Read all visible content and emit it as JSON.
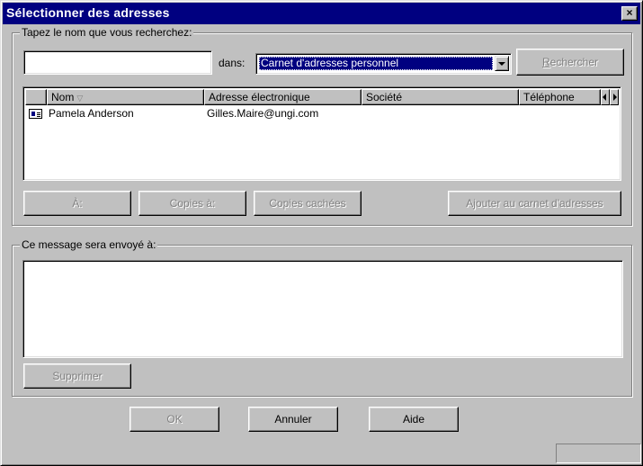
{
  "window": {
    "title": "Sélectionner des adresses",
    "close_label": "×"
  },
  "search_group": {
    "label": "Tapez le nom que vous recherchez:",
    "search_value": "",
    "in_label": "dans:",
    "directory_selected": "Carnet d'adresses personnel",
    "search_button": "Rechercher"
  },
  "results": {
    "columns": [
      "Nom",
      "Adresse électronique",
      "Société",
      "Téléphone"
    ],
    "sort_indicator": "▽",
    "rows": [
      {
        "name": "Pamela Anderson",
        "email": "Gilles.Maire@ungi.com",
        "company": "",
        "phone": ""
      }
    ]
  },
  "action_buttons": {
    "to": "À:",
    "cc": "Copies à:",
    "bcc": "Copies cachées",
    "add_to_book": "Ajouter au carnet d'adresses"
  },
  "recipients_group": {
    "label": "Ce message sera envoyé à:",
    "remove_button": "Supprimer"
  },
  "footer": {
    "ok": "OK",
    "cancel": "Annuler",
    "help": "Aide"
  },
  "colors": {
    "title_bar": "#000080",
    "face": "#c0c0c0",
    "selection": "#000080",
    "disabled_text": "#808080"
  }
}
